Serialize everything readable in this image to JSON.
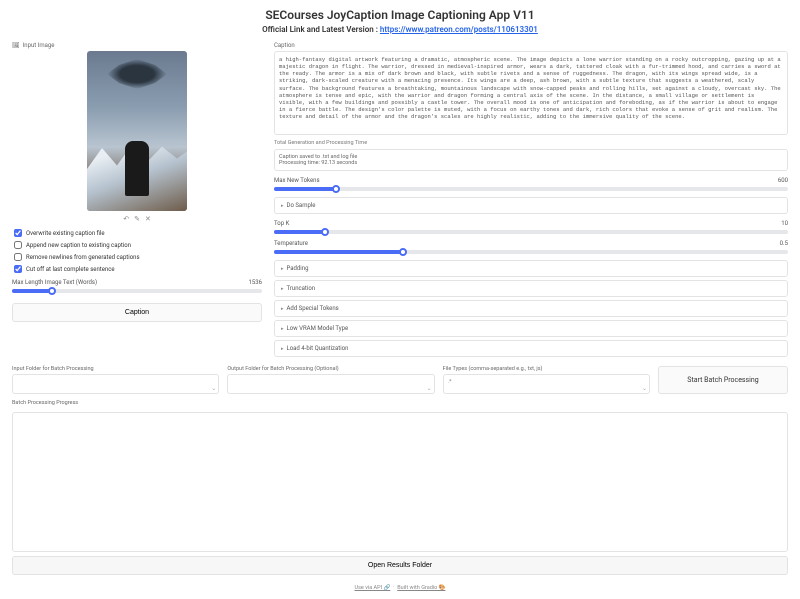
{
  "header": {
    "title": "SECourses JoyCaption Image Captioning App V11",
    "subtitle_prefix": "Official Link and Latest Version : ",
    "subtitle_link": "https://www.patreon.com/posts/110613301"
  },
  "left": {
    "input_image_label": "Input Image",
    "checkboxes": {
      "overwrite": "Overwrite existing caption file",
      "append": "Append new caption to existing caption",
      "remove_newlines": "Remove newlines from generated captions",
      "cutoff": "Cut off at last complete sentence"
    },
    "checked": {
      "overwrite": true,
      "append": false,
      "remove_newlines": false,
      "cutoff": true
    },
    "slider": {
      "label": "Max Length Image Text (Words)",
      "value": "1536"
    },
    "caption_btn": "Caption"
  },
  "right": {
    "caption_label": "Caption",
    "caption_text": "a high-fantasy digital artwork featuring a dramatic, atmospheric scene. The image depicts a lone warrior standing on a rocky outcropping, gazing up at a majestic dragon in flight. The warrior, dressed in medieval-inspired armor, wears a dark, tattered cloak with a fur-trimmed hood, and carries a sword at the ready. The armor is a mix of dark brown and black, with subtle rivets and a sense of ruggedness. The dragon, with its wings spread wide, is a striking, dark-scaled creature with a menacing presence. Its wings are a deep, ash brown, with a subtle texture that suggests a weathered, scaly surface. The background features a breathtaking, mountainous landscape with snow-capped peaks and rolling hills, set against a cloudy, overcast sky. The atmosphere is tense and epic, with the warrior and dragon forming a central axis of the scene. In the distance, a small village or settlement is visible, with a few buildings and possibly a castle tower. The overall mood is one of anticipation and foreboding, as if the warrior is about to engage in a fierce battle. The design's color palette is muted, with a focus on earthy tones and dark, rich colors that evoke a sense of grit and realism. The texture and detail of the armor and the dragon's scales are highly realistic, adding to the immersive quality of the scene.",
    "gen_time_label": "Total Generation and Processing Time",
    "gen_info_line1": "Caption saved to .txt and log file",
    "gen_info_line2": "Processing time: 92.13 seconds",
    "sliders": {
      "max_new_tokens": {
        "label": "Max New Tokens",
        "value": "600"
      },
      "top_k": {
        "label": "Top K",
        "value": "10"
      },
      "temperature": {
        "label": "Temperature",
        "value": "0.5"
      }
    },
    "accordions": {
      "do_sample": "Do Sample",
      "padding": "Padding",
      "truncation": "Truncation",
      "special_tokens": "Add Special Tokens",
      "load_vlm": "Low VRAM Model Type",
      "load_4bit": "Load 4-bit Quantization"
    }
  },
  "bottom": {
    "input_folder": "Input Folder for Batch Processing",
    "output_folder": "Output Folder for Batch Processing (Optional)",
    "types": {
      "label": "File Types (comma-separated e.g., txt, js)",
      "value": ".*"
    },
    "start_batch": "Start Batch Processing",
    "progress_label": "Batch Processing Progress",
    "open_folder": "Open Results Folder"
  },
  "footer": {
    "left": "Use via API 🔗",
    "right": "Built with Gradio 🎨"
  }
}
